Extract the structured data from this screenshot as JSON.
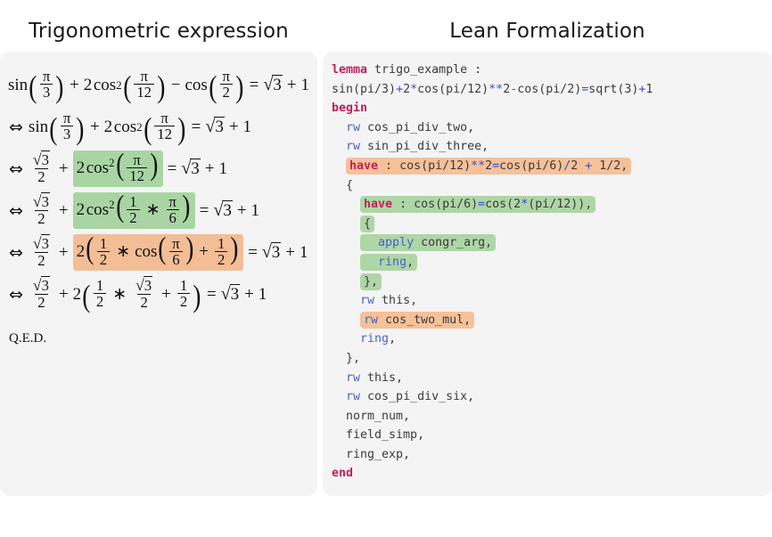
{
  "left_panel": {
    "title": "Trigonometric expression",
    "qed": "Q.E.D.",
    "lines": [
      {
        "id": "eq1",
        "prefix": "",
        "text": "sin(pi/3) + 2 cos^2(pi/12) - cos(pi/2) = sqrt(3) + 1",
        "highlight": "none"
      },
      {
        "id": "eq2",
        "prefix": "⇔",
        "text": "sin(pi/3) + 2 cos^2(pi/12) = sqrt(3) + 1",
        "highlight": "none"
      },
      {
        "id": "eq3",
        "prefix": "⇔",
        "text": "sqrt(3)/2 + 2 cos^2(pi/12) = sqrt(3) + 1",
        "highlight": "green",
        "highlight_part": "2 cos^2(pi/12)"
      },
      {
        "id": "eq4",
        "prefix": "⇔",
        "text": "sqrt(3)/2 + 2 cos^2(1/2 * pi/6) = sqrt(3) + 1",
        "highlight": "green",
        "highlight_part": "2 cos^2(1/2 * pi/6)"
      },
      {
        "id": "eq5",
        "prefix": "⇔",
        "text": "sqrt(3)/2 + 2 (1/2 * cos(pi/6) + 1/2) = sqrt(3) + 1",
        "highlight": "orange",
        "highlight_part": "2 (1/2 * cos(pi/6) + 1/2)"
      },
      {
        "id": "eq6",
        "prefix": "⇔",
        "text": "sqrt(3)/2 + 2 (1/2 * sqrt(3)/2 + 1/2) = sqrt(3) + 1",
        "highlight": "none"
      }
    ],
    "symbols": {
      "iff": "⇔",
      "pi": "π",
      "times": "∗",
      "plus": "+",
      "minus": "−",
      "equals": "=",
      "radical": "√",
      "lparen": "(",
      "rparen": ")",
      "sin": "sin",
      "cos": "cos",
      "sup2": "2"
    }
  },
  "right_panel": {
    "title": "Lean Formalization",
    "code_lines": [
      {
        "n": 1,
        "highlight": "none",
        "tokens": [
          {
            "t": "lemma ",
            "c": "kw"
          },
          {
            "t": "trigo_example :",
            "c": "id"
          }
        ]
      },
      {
        "n": 2,
        "highlight": "none",
        "tokens": [
          {
            "t": "sin(pi/3)",
            "c": "id"
          },
          {
            "t": "+",
            "c": "opc"
          },
          {
            "t": "2",
            "c": "id"
          },
          {
            "t": "*",
            "c": "opc"
          },
          {
            "t": "cos(pi/12)",
            "c": "id"
          },
          {
            "t": "**",
            "c": "opc"
          },
          {
            "t": "2",
            "c": "id"
          },
          {
            "t": "-",
            "c": "opc"
          },
          {
            "t": "cos(pi/2)",
            "c": "id"
          },
          {
            "t": "=",
            "c": "opc"
          },
          {
            "t": "sqrt(3)",
            "c": "id"
          },
          {
            "t": "+",
            "c": "opc"
          },
          {
            "t": "1",
            "c": "id"
          }
        ]
      },
      {
        "n": 3,
        "highlight": "none",
        "tokens": [
          {
            "t": "begin",
            "c": "kw"
          }
        ]
      },
      {
        "n": 4,
        "highlight": "none",
        "tokens": [
          {
            "t": "  ",
            "c": "id"
          },
          {
            "t": "rw",
            "c": "tac"
          },
          {
            "t": " cos_pi_div_two,",
            "c": "id"
          }
        ]
      },
      {
        "n": 5,
        "highlight": "none",
        "tokens": [
          {
            "t": "  ",
            "c": "id"
          },
          {
            "t": "rw",
            "c": "tac"
          },
          {
            "t": " sin_pi_div_three,",
            "c": "id"
          }
        ]
      },
      {
        "n": 6,
        "highlight": "orange-solo",
        "indent": 2,
        "tokens": [
          {
            "t": "have",
            "c": "kw"
          },
          {
            "t": " : cos(pi/12)",
            "c": "id"
          },
          {
            "t": "**",
            "c": "opc"
          },
          {
            "t": "2",
            "c": "id"
          },
          {
            "t": "=",
            "c": "opc"
          },
          {
            "t": "cos(pi/6)",
            "c": "id"
          },
          {
            "t": "/",
            "c": "opc"
          },
          {
            "t": "2 ",
            "c": "id"
          },
          {
            "t": "+",
            "c": "opc"
          },
          {
            "t": " 1/2,",
            "c": "id"
          }
        ]
      },
      {
        "n": 7,
        "highlight": "none",
        "tokens": [
          {
            "t": "  {",
            "c": "id"
          }
        ]
      },
      {
        "n": 8,
        "highlight": "green-top",
        "indent": 4,
        "tokens": [
          {
            "t": "have",
            "c": "kw"
          },
          {
            "t": " : cos(pi/6)",
            "c": "id"
          },
          {
            "t": "=",
            "c": "opc"
          },
          {
            "t": "cos(2",
            "c": "id"
          },
          {
            "t": "*",
            "c": "opc"
          },
          {
            "t": "(pi/12)),",
            "c": "id"
          }
        ]
      },
      {
        "n": 9,
        "highlight": "green-mid",
        "indent": 4,
        "tokens": [
          {
            "t": "{",
            "c": "id"
          }
        ]
      },
      {
        "n": 10,
        "highlight": "green-mid",
        "indent": 4,
        "tokens": [
          {
            "t": "  ",
            "c": "id"
          },
          {
            "t": "apply",
            "c": "tac"
          },
          {
            "t": " congr_arg,",
            "c": "id"
          }
        ]
      },
      {
        "n": 11,
        "highlight": "green-mid",
        "indent": 4,
        "tokens": [
          {
            "t": "  ",
            "c": "id"
          },
          {
            "t": "ring",
            "c": "tac"
          },
          {
            "t": ",",
            "c": "id"
          }
        ]
      },
      {
        "n": 12,
        "highlight": "green-bot",
        "indent": 4,
        "tokens": [
          {
            "t": "},",
            "c": "id"
          }
        ]
      },
      {
        "n": 13,
        "highlight": "none",
        "tokens": [
          {
            "t": "    ",
            "c": "id"
          },
          {
            "t": "rw",
            "c": "tac"
          },
          {
            "t": " this,",
            "c": "id"
          }
        ]
      },
      {
        "n": 14,
        "highlight": "orange-solo",
        "indent": 4,
        "tokens": [
          {
            "t": "rw",
            "c": "tac"
          },
          {
            "t": " cos_two_mul,",
            "c": "id"
          }
        ]
      },
      {
        "n": 15,
        "highlight": "none",
        "tokens": [
          {
            "t": "    ",
            "c": "id"
          },
          {
            "t": "ring",
            "c": "tac"
          },
          {
            "t": ",",
            "c": "id"
          }
        ]
      },
      {
        "n": 16,
        "highlight": "none",
        "tokens": [
          {
            "t": "  },",
            "c": "id"
          }
        ]
      },
      {
        "n": 17,
        "highlight": "none",
        "tokens": [
          {
            "t": "  ",
            "c": "id"
          },
          {
            "t": "rw",
            "c": "tac"
          },
          {
            "t": " this,",
            "c": "id"
          }
        ]
      },
      {
        "n": 18,
        "highlight": "none",
        "tokens": [
          {
            "t": "  ",
            "c": "id"
          },
          {
            "t": "rw",
            "c": "tac"
          },
          {
            "t": " cos_pi_div_six,",
            "c": "id"
          }
        ]
      },
      {
        "n": 19,
        "highlight": "none",
        "tokens": [
          {
            "t": "  norm_num,",
            "c": "id"
          }
        ]
      },
      {
        "n": 20,
        "highlight": "none",
        "tokens": [
          {
            "t": "  field_simp,",
            "c": "id"
          }
        ]
      },
      {
        "n": 21,
        "highlight": "none",
        "tokens": [
          {
            "t": "  ring_exp,",
            "c": "id"
          }
        ]
      },
      {
        "n": 22,
        "highlight": "none",
        "tokens": [
          {
            "t": "end",
            "c": "kw"
          }
        ]
      }
    ]
  },
  "colors": {
    "panel_bg": "#f4f4f5",
    "page_bg": "#ffffff",
    "keyword": "#c41e5a",
    "tactic": "#4662c8",
    "operator": "#3050d8",
    "identifier": "#3b3b3b",
    "highlight_green": "#aed6a6",
    "highlight_orange": "#f5c199",
    "math_green": "#a9d5a3",
    "math_orange": "#f3bd95",
    "title": "#1a1a1a"
  }
}
